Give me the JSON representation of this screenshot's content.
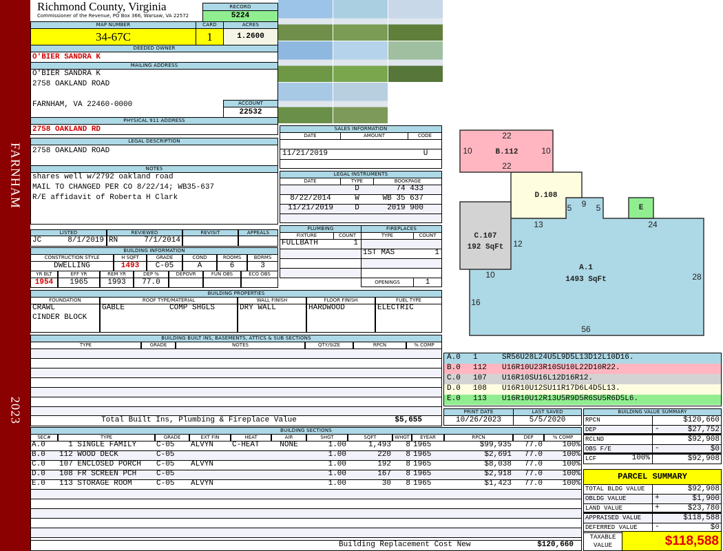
{
  "county": {
    "title": "Richmond County, Virginia",
    "subtitle": "Commissioner of the Revenue, PO Box 366, Warsaw, VA 22572"
  },
  "sidebar": {
    "district": "FARNHAM",
    "year": "2023"
  },
  "record": {
    "label": "RECORD",
    "value": "5224"
  },
  "map": {
    "label": "MAP NUMBER",
    "value": "34-67C"
  },
  "card": {
    "label": "CARD",
    "value": "1"
  },
  "acres": {
    "label": "ACRES",
    "value": "1.2600"
  },
  "owner": {
    "label": "DEEDED OWNER",
    "value": "O'BIER SANDRA K"
  },
  "mailing": {
    "label": "MAILING ADDRESS",
    "lines": [
      "O'BIER SANDRA K",
      "2758 OAKLAND ROAD",
      "",
      "FARNHAM, VA 22460-0000"
    ]
  },
  "account": {
    "label": "ACCOUNT",
    "value": "22532"
  },
  "physical": {
    "label": "PHYSICAL 911 ADDRESS",
    "value": "2758 OAKLAND RD"
  },
  "legal": {
    "label": "LEGAL DESCRIPTION",
    "value": "2758 OAKLAND ROAD"
  },
  "notes": {
    "label": "NOTES",
    "lines": [
      "shares well w/2792 oakland road",
      "MAIL TO CHANGED PER CO 8/22/14; WB35-637",
      "R/E affidavit of Roberta H Clark"
    ]
  },
  "review": {
    "headers": [
      "LISTED",
      "REVIEWED",
      "REVISIT",
      "APPEALS"
    ],
    "listed_by": "JC",
    "listed_date": "8/1/2019",
    "reviewed_by": "RN",
    "reviewed_date": "7/1/2014"
  },
  "building_info": {
    "label": "BUILDING INFORMATION",
    "headers1": [
      "CONSTRUCTION STYLE",
      "H SQFT",
      "GRADE",
      "COND",
      "ROOMS",
      "BDRMS"
    ],
    "values1": [
      "DWELLING",
      "1493",
      "C-05",
      "A",
      "6",
      "3"
    ],
    "headers2": [
      "YR BLT",
      "EFF YR",
      "REM YR",
      "DEP %",
      "DEPOVR",
      "FUN OBS",
      "ECO OBS"
    ],
    "values2": [
      "1954",
      "1965",
      "1993",
      "77.0",
      "",
      "",
      ""
    ]
  },
  "properties": {
    "label": "BUILDING PROPERTIES",
    "headers": [
      "FOUNDATION",
      "ROOF TYPE/MATERIAL",
      "WALL FINISH",
      "FLOOR FINISH",
      "FUEL TYPE"
    ],
    "foundation": [
      "CRAWL",
      "CINDER BLOCK"
    ],
    "roof_type": "GABLE",
    "roof_material": "COMP SHGLS",
    "wall": "DRY WALL",
    "floor": "HARDWOOD",
    "fuel": "ELECTRIC"
  },
  "builtins": {
    "label": "BUILDING BUILT INS, BASEMENTS, ATTICS & SUB SECTIONS",
    "headers": [
      "TYPE",
      "GRADE",
      "NOTES",
      "QTY/SIZE",
      "RPCN",
      "% COMP"
    ],
    "total_label": "Total Built Ins, Plumbing & Fireplace Value",
    "total_value": "$5,655"
  },
  "sales": {
    "label": "SALES INFORMATION",
    "headers": [
      "DATE",
      "AMOUNT",
      "CODE"
    ],
    "date": "11/21/2019",
    "code": "U"
  },
  "instruments": {
    "label": "LEGAL INSTRUMENTS",
    "headers": [
      "DATE",
      "TYPE",
      "BOOKPAGE"
    ],
    "rows": [
      [
        "",
        "D",
        "74 433"
      ],
      [
        "8/22/2014",
        "W",
        "WB 35 637"
      ],
      [
        "11/21/2019",
        "D",
        "2019 900"
      ]
    ]
  },
  "plumbing": {
    "label": "PLUMBING",
    "headers": [
      "FIXTURE",
      "COUNT"
    ],
    "fixture": "FULLBATH",
    "count": "1"
  },
  "fireplaces": {
    "label": "FIREPLACES",
    "headers": [
      "TYPE",
      "COUNT"
    ],
    "type": "1ST MAS",
    "count": "1",
    "openings_label": "OPENINGS",
    "openings": "1"
  },
  "sketch": {
    "dims": [
      "22",
      "10",
      "10",
      "22",
      "5",
      "9",
      "5",
      "13",
      "24",
      "12",
      "10",
      "28",
      "16",
      "56"
    ],
    "areas": [
      "B.112",
      "D.108",
      "E",
      "C.107",
      "192 SqFt",
      "A.1",
      "1493 SqFt"
    ],
    "colors": {
      "A": "#add8e6",
      "B": "#ffb6c1",
      "C": "#d3d3d3",
      "D": "#fffde0",
      "E": "#90ee90"
    }
  },
  "sketch_legend": [
    {
      "sec": "A.0",
      "code": "1",
      "path": "SR56U28L24U5L9D5L13D12L10D16.",
      "color": "#add8e6"
    },
    {
      "sec": "B.0",
      "code": "112",
      "path": "U16R10U23R10SU10L22D10R22.",
      "color": "#ffb6c1"
    },
    {
      "sec": "C.0",
      "code": "107",
      "path": "U16R10SU16L12D16R12.",
      "color": "#d3d3d3"
    },
    {
      "sec": "D.0",
      "code": "108",
      "path": "U16R10U12SU11R17D6L4D5L13.",
      "color": "#fffde0"
    },
    {
      "sec": "E.0",
      "code": "113",
      "path": "U16R10U12R13U5R9D5R6SU5R6D5L6.",
      "color": "#90ee90"
    }
  ],
  "dates": {
    "print_label": "PRINT DATE",
    "print": "10/26/2023",
    "saved_label": "LAST SAVED",
    "saved": "5/5/2020"
  },
  "sections": {
    "label": "BUILDING SECTIONS",
    "headers": [
      "SEC#",
      "TYPE",
      "GRADE",
      "EXT FIN",
      "HEAT",
      "AIR",
      "SHGT",
      "SQFT",
      "WHGT",
      "EYEAR",
      "RPCN",
      "DEP",
      "% COMP"
    ],
    "rows": [
      [
        "A.0",
        "  1 SINGLE FAMILY",
        "C-05",
        "ALVYN",
        "C-HEAT",
        "NONE",
        "1.00",
        "1,493",
        "8",
        "1965",
        "$99,935",
        "77.0",
        "100%"
      ],
      [
        "B.0",
        "112 WOOD DECK",
        "C-05",
        "",
        "",
        "",
        "1.00",
        "220",
        "8",
        "1965",
        "$2,691",
        "77.0",
        "100%"
      ],
      [
        "C.0",
        "107 ENCLOSED PORCH",
        "C-05",
        "ALVYN",
        "",
        "",
        "1.00",
        "192",
        "8",
        "1965",
        "$8,038",
        "77.0",
        "100%"
      ],
      [
        "D.0",
        "108 FR SCREEN PCH",
        "C-05",
        "",
        "",
        "",
        "1.00",
        "167",
        "8",
        "1965",
        "$2,918",
        "77.0",
        "100%"
      ],
      [
        "E.0",
        "113 STORAGE ROOM",
        "C-05",
        "ALVYN",
        "",
        "",
        "1.00",
        "30",
        "8",
        "1965",
        "$1,423",
        "77.0",
        "100%"
      ]
    ],
    "total_label": "Building Replacement Cost New",
    "total_value": "$120,660"
  },
  "value_summary": {
    "label": "BUILDING VALUE SUMMARY",
    "rows": [
      {
        "label": "RPCN",
        "extra": "",
        "sign": "",
        "value": "$120,660"
      },
      {
        "label": "DEP",
        "extra": "",
        "sign": "-",
        "value": "$27,752"
      },
      {
        "label": "RCLND",
        "extra": "",
        "sign": "",
        "value": "$92,908"
      },
      {
        "label": "OBS F/E",
        "extra": "",
        "sign": "-",
        "value": "$0"
      },
      {
        "label": "LCF",
        "extra": "100%",
        "sign": "",
        "value": "$92,908"
      }
    ]
  },
  "parcel": {
    "label": "PARCEL SUMMARY",
    "rows": [
      {
        "label": "TOTAL BLDG VALUE",
        "sign": "",
        "value": "$92,908"
      },
      {
        "label": "OBLDG VALUE",
        "sign": "+",
        "value": "$1,900"
      },
      {
        "label": "LAND VALUE",
        "sign": "+",
        "value": "$23,780"
      },
      {
        "label": "APPRAISED VALUE",
        "sign": "",
        "value": "$118,588"
      },
      {
        "label": "DEFERRED VALUE",
        "sign": "-",
        "value": "$0"
      }
    ],
    "taxable_label": "TAXABLE\nVALUE",
    "taxable": "$118,588"
  }
}
